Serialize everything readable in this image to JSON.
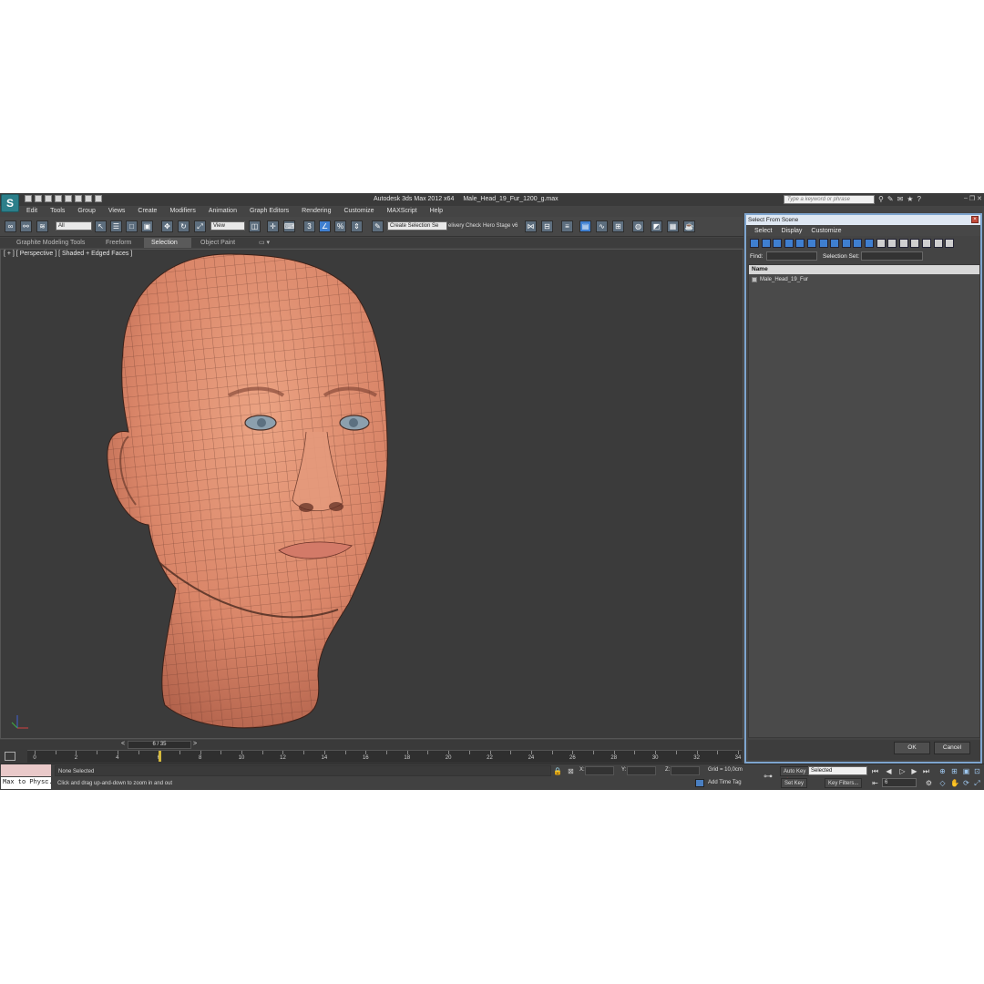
{
  "titlebar": {
    "app_name": "Autodesk 3ds Max  2012 x64",
    "file_name": "Male_Head_19_Fur_1200_g.max",
    "search_placeholder": "Type a keyword or phrase"
  },
  "menu": [
    "Edit",
    "Tools",
    "Group",
    "Views",
    "Create",
    "Modifiers",
    "Animation",
    "Graph Editors",
    "Rendering",
    "Customize",
    "MAXScript",
    "Help"
  ],
  "toolbar": {
    "selection_filter": "All",
    "reference_coord": "View",
    "named_selection_set": "Create Selection Se",
    "delivery_check": "elivery Check",
    "hero_stage": "Hero Stage v6"
  },
  "ribbon_tabs": [
    "Graphite Modeling Tools",
    "Freeform",
    "Selection",
    "Object Paint"
  ],
  "ribbon_active": "Selection",
  "viewport": {
    "label": "[ + ] [ Perspective ] [ Shaded + Edged Faces ]"
  },
  "timeline": {
    "frame_display": "6 / 35",
    "current_frame": 6,
    "total_frames": 35,
    "ticks": [
      "0",
      "2",
      "4",
      "6",
      "8",
      "10",
      "12",
      "14",
      "16",
      "18",
      "20",
      "22",
      "24",
      "26",
      "28",
      "30",
      "32",
      "34"
    ]
  },
  "status": {
    "maxscript_listener": "Max to Physc.",
    "selection_status": "None Selected",
    "prompt": "Click and drag up-and-down to zoom in and out",
    "x_label": "X:",
    "y_label": "Y:",
    "z_label": "Z:",
    "grid": "Grid = 10,0cm",
    "add_time_tag": "Add Time Tag",
    "auto_key": "Auto Key",
    "set_key": "Set Key",
    "key_mode": "Selected",
    "key_filters": "Key Filters...",
    "frame_field": "6"
  },
  "dialog": {
    "title": "Select From Scene",
    "menu": [
      "Select",
      "Display",
      "Customize"
    ],
    "find_label": "Find:",
    "selection_set_label": "Selection Set:",
    "column_name": "Name",
    "objects": [
      "Male_Head_19_Fur"
    ],
    "ok": "OK",
    "cancel": "Cancel"
  },
  "colors": {
    "viewport_bg": "#3b3b3b",
    "skin": "#d9876a",
    "wire": "#4a2a20",
    "dialog_border": "#7ea5cf",
    "accent_blue": "#3f7fd0",
    "frame_marker": "#d4b83c"
  }
}
